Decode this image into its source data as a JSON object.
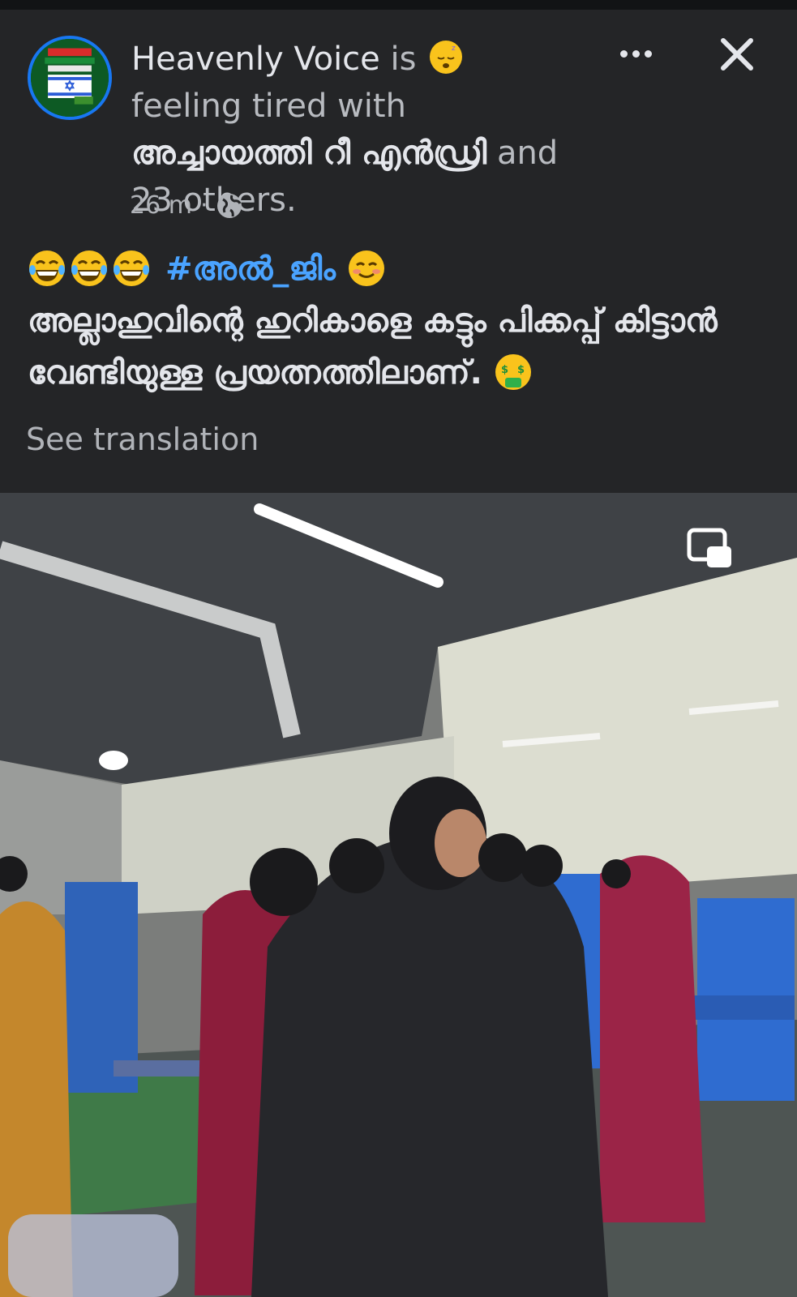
{
  "post": {
    "author": "Heavenly Voice",
    "is": "is",
    "feeling": "feeling",
    "feeling_state": "tired",
    "with": "with",
    "tagged": "അച്ചായത്തി റീ എൻഡ്രി",
    "and_others": "and 23 others.",
    "time": "26 m",
    "separator": "·",
    "hashtag": "#അൽ_ജിം",
    "body": "അല്ലാഹുവിന്റെ ഹുറികാളെ കട്ടും പിക്കപ്പ് കിട്ടാൻ വേണ്ടിയുള്ള പ്രയത്നത്തിലാണ്.",
    "see_translation": "See translation"
  },
  "icons": {
    "more": "more-dots-icon",
    "close": "close-icon",
    "audience": "globe-icon",
    "pip": "picture-in-picture-icon"
  },
  "colors": {
    "background": "#242527",
    "hashtag": "#4aa3ff",
    "avatar_ring": "#1877f2",
    "secondary_text": "#b0b3b8"
  }
}
